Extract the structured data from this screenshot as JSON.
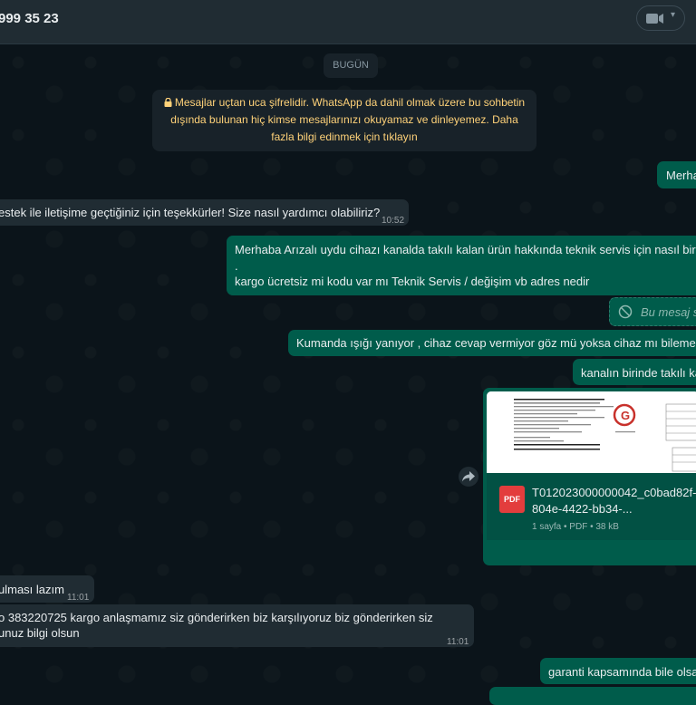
{
  "header": {
    "contact_title": "999 35 23",
    "video_icon": "video-camera-icon",
    "caret_icon": "chevron-down-icon"
  },
  "chat": {
    "date_label": "BUGÜN",
    "encryption_notice": "Mesajlar uçtan uca şifrelidir. WhatsApp da dahil olmak üzere bu sohbetin dışında bulunan hiç kimse mesajlarınızı okuyamaz ve dinleyemez. Daha fazla bilgi edinmek için tıklayın",
    "messages": {
      "m1": {
        "text": "Merha"
      },
      "m2": {
        "text": "estek ile iletişime geçtiğiniz için teşekkürler! Size nasıl yardımcı olabiliriz?",
        "time": "10:52"
      },
      "m3": {
        "line1": "Merhaba Arızalı uydu cihazı kanalda takılı kalan ürün hakkında teknik servis için nasıl bir y",
        "line2": ".",
        "line3": "kargo ücretsiz mi kodu var mı Teknik Servis / değişim vb adres nedir"
      },
      "m4": {
        "text": "Bu mesaj s"
      },
      "m5": {
        "text": "Kumanda ışığı yanıyor , cihaz cevap vermiyor göz mü yoksa cihaz mı bilemedi"
      },
      "m6": {
        "text": "kanalın birinde takılı ka"
      },
      "m7": {
        "filename_line1": "T012023000000042_c0bad82f-",
        "filename_line2": "804e-4422-bb34-...",
        "meta": "1 sayfa • PDF • 38 kB",
        "badge": "PDF"
      },
      "m8": {
        "text": "ulması lazım",
        "time": "11:01"
      },
      "m9": {
        "line1": "o 383220725 kargo anlaşmamız siz gönderirken biz karşılıyoruz biz gönderirken siz",
        "line2": "unuz bilgi olsun",
        "time": "11:01"
      },
      "m10": {
        "text": "garanti kapsamında bile olsa"
      }
    }
  }
}
